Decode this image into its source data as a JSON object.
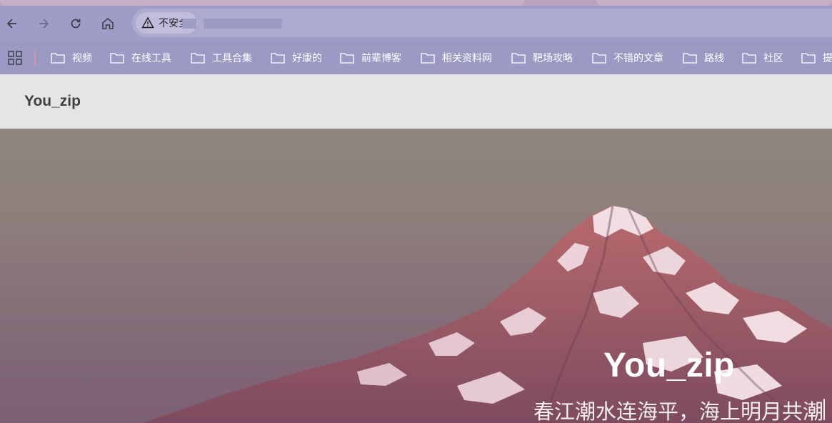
{
  "browser": {
    "security_label": "不安全",
    "bookmarks": [
      "视频",
      "在线工具",
      "工具合集",
      "好康的",
      "前辈博客",
      "相关资料网",
      "靶场攻略",
      "不错的文章",
      "路线",
      "社区",
      "提"
    ]
  },
  "site": {
    "brand": "You_zip"
  },
  "hero": {
    "title": "You_zip",
    "subtitle": "春江潮水连海平，海上明月共潮"
  },
  "colors": {
    "toolbar": "#9f9dc7",
    "omnibox": "#aeabd0",
    "header_bg": "#e7e5e4",
    "hero_text": "#ffffff"
  }
}
